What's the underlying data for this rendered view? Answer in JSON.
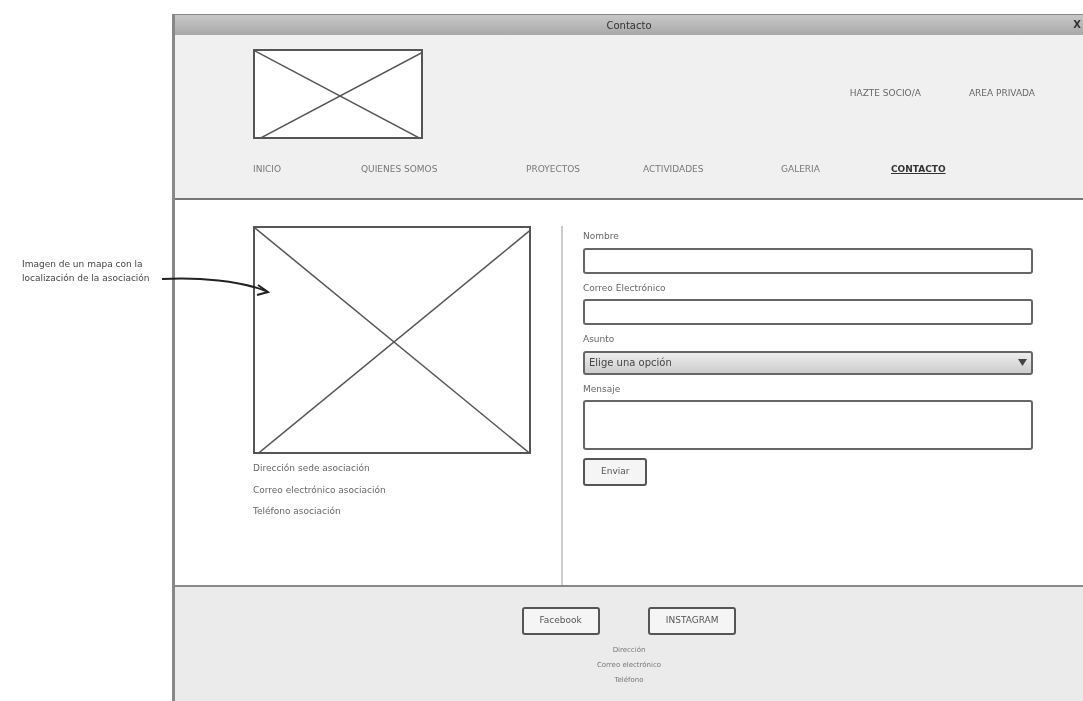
{
  "annotation": {
    "text": "Imagen de un mapa con la localización de la asociación"
  },
  "window": {
    "title": "Contacto",
    "close": "X"
  },
  "header": {
    "links": [
      "HAZTE SOCIO/A",
      "AREA PRIVADA"
    ]
  },
  "nav": [
    {
      "label": "INICIO",
      "selected": false
    },
    {
      "label": "QUIENES SOMOS",
      "selected": false
    },
    {
      "label": "PROYECTOS",
      "selected": false
    },
    {
      "label": "ACTIVIDADES",
      "selected": false
    },
    {
      "label": "GALERIA",
      "selected": false
    },
    {
      "label": "CONTACTO",
      "selected": true
    }
  ],
  "info": [
    "Dirección sede asociación",
    "Correo electrónico asociación",
    "Teléfono asociación"
  ],
  "form": {
    "fields": [
      {
        "label": "Nombre",
        "kind": "input"
      },
      {
        "label": "Correo Electrónico",
        "kind": "input"
      },
      {
        "label": "Asunto",
        "kind": "select",
        "value": "Elige una opción"
      },
      {
        "label": "Mensaje",
        "kind": "textarea"
      }
    ],
    "submit": "Enviar"
  },
  "footer": {
    "buttons": [
      "Facebook",
      "INSTAGRAM"
    ],
    "lines": [
      "Dirección",
      "Correo electrónico",
      "Teléfono"
    ]
  }
}
